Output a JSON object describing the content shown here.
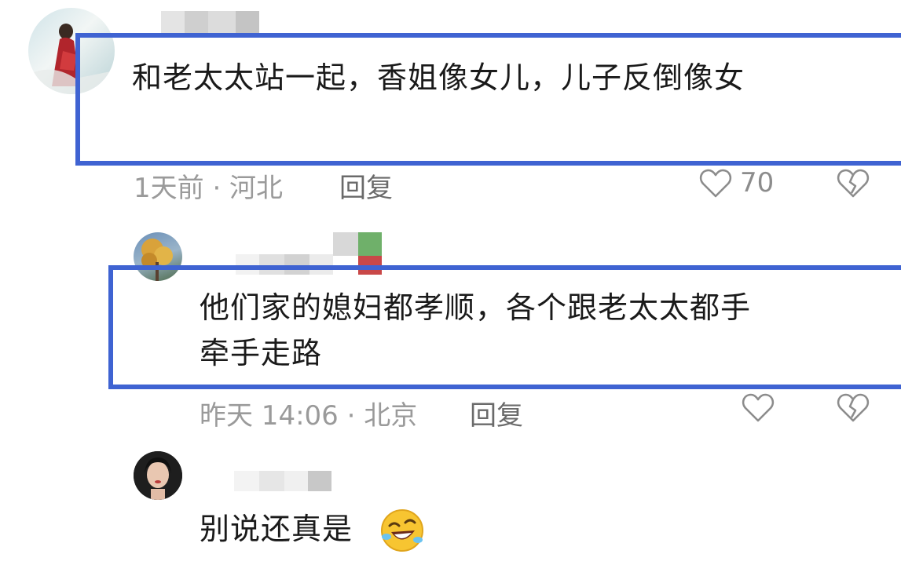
{
  "comments": [
    {
      "text": "和老太太站一起，香姐像女儿，儿子反倒像女",
      "time_location": "1天前 · 河北",
      "reply_label": "回复",
      "likes": "70",
      "avatar_icon": "woman-red-dress-avatar"
    },
    {
      "text_line1": "他们家的媳妇都孝顺，各个跟老太太都手",
      "text_line2": "牵手走路",
      "time_location": "昨天 14:06 · 北京",
      "reply_label": "回复",
      "avatar_icon": "autumn-tree-avatar"
    },
    {
      "text": "别说还真是",
      "emoji_icon": "rolling-laughing-emoji",
      "avatar_icon": "woman-portrait-avatar"
    }
  ],
  "colors": {
    "highlight_border": "#3f63d2",
    "meta_text": "#9a9a9a",
    "reply_text": "#6a6a6a"
  }
}
